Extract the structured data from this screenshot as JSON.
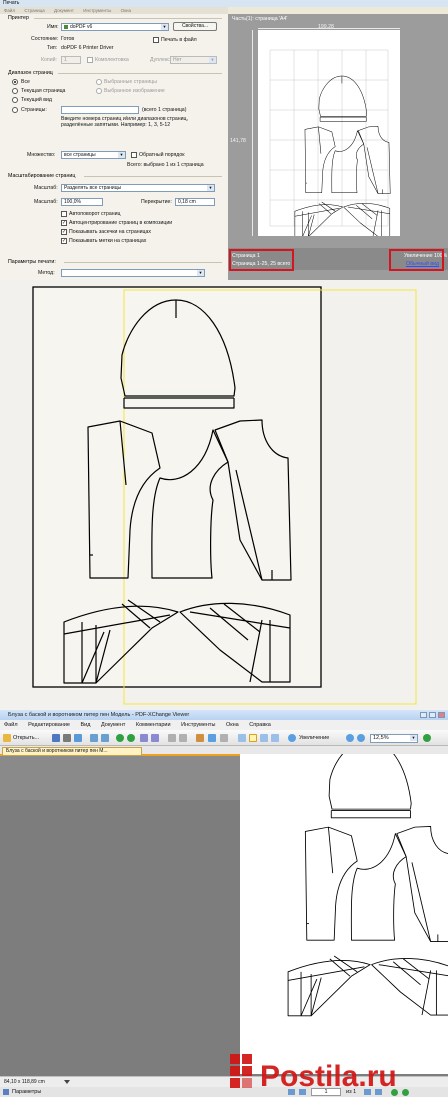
{
  "dialog": {
    "title": "Печать",
    "menu": [
      "Файл",
      "Страница",
      "Документ",
      "Инструменты",
      "Окна"
    ],
    "printer": {
      "group": "Принтер",
      "name_label": "Имя:",
      "name_value": "doPDF v6",
      "properties_button": "Свойства...",
      "state_label": "Состояние:",
      "state_value": "Готов",
      "type_label": "Тип:",
      "type_value": "doPDF  6 Printer Driver",
      "print_to_file": "Печать в файл",
      "copies_label": "Копий:",
      "copies_value": "1",
      "collate": "Комплектовка",
      "duplex_label": "Дуплекс:",
      "duplex_value": "Нет"
    },
    "range": {
      "group": "Диапазон страниц",
      "all": "Все",
      "current_page": "Текущая страница",
      "current_view": "Текущий вид",
      "pages": "Страницы:",
      "pages_total": "(всего 1 страница)",
      "selected_pages": "Выбранные страницы",
      "selected_image": "Выбранное изображение",
      "hint": "Введите номера страниц и/или диапазонов страниц, разделённые запятыми. Например: 1, 3, 5-12",
      "subset_label": "Множество:",
      "subset_value": "все страницы",
      "reverse": "Обратный порядок",
      "selected_total": "Всего: выбрано 1 из 1 страница"
    },
    "scaling": {
      "group": "Масштабирование страниц",
      "scale_label": "Масштаб:",
      "scale_value": "Разделять все страницы",
      "zoom_label": "Масштаб:",
      "zoom_value": "100,0%",
      "overlap_label": "Перекрытие:",
      "overlap_value": "0,18 cm",
      "auto_rotate": "Автоповорот страниц",
      "auto_center": "Автоцентрирование страниц в композиции",
      "show_cut_marks": "Показывать засечки на страницах",
      "show_page_labels": "Показывать метки на страницах"
    },
    "output": {
      "group": "Параметры печати:",
      "label": "Метод:"
    },
    "preview": {
      "header": "Часть(1): страница 'A4'",
      "width_label": "199,28",
      "height_label": "141,78",
      "status_left_1": "Страница 1",
      "status_left_2": "Страница 1-25, 25 всего",
      "status_right_1": "Увеличение 100%",
      "status_right_2": "Обычный вид"
    }
  },
  "viewer": {
    "title": "Блуза с баской и воротником питер пен Модель - PDF-XChange Viewer",
    "menu": [
      "Файл",
      "Редактирование",
      "Вид",
      "Документ",
      "Комментарии",
      "Инструменты",
      "Окна",
      "Справка"
    ],
    "open_button": "Открыть...",
    "zoom_button": "Увеличение",
    "zoom_value": "12,5%",
    "tab_title": "Блуза с баской и воротником питер пен М...",
    "status_size": "84,10 x 118,89 cm",
    "params_button": "Параметры",
    "page_current": "1",
    "page_total": "из 1"
  },
  "watermark": "Postila.ru",
  "colors": {
    "red_highlight": "#d4141e",
    "guide_yellow": "#f2e640",
    "tab_orange": "#f0a020",
    "watermark_red": "#d21414"
  }
}
